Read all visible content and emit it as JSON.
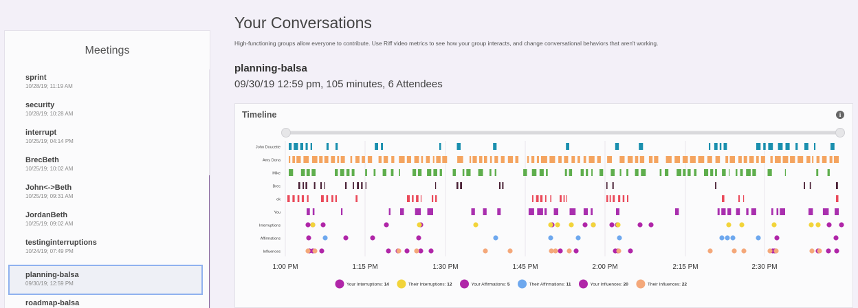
{
  "sidebar": {
    "title": "Meetings",
    "items": [
      {
        "name": "sprint",
        "date": "10/28/19; 11:19 AM"
      },
      {
        "name": "security",
        "date": "10/28/19; 10:28 AM"
      },
      {
        "name": "interrupt",
        "date": "10/25/19; 04:14 PM"
      },
      {
        "name": "BrecBeth",
        "date": "10/25/19; 10:02 AM"
      },
      {
        "name": "John<->Beth",
        "date": "10/25/19; 09:31 AM"
      },
      {
        "name": "JordanBeth",
        "date": "10/25/19; 09:02 AM"
      },
      {
        "name": "testinginterruptions",
        "date": "10/24/19; 07:49 PM"
      },
      {
        "name": "planning-balsa",
        "date": "09/30/19; 12:59 PM"
      },
      {
        "name": "roadmap-balsa",
        "date": ""
      }
    ],
    "selected_index": 7
  },
  "main": {
    "title": "Your Conversations",
    "intro": "High-functioning groups allow everyone to contribute. Use Riff video metrics to see how your group interacts, and change conversational behaviors that aren't working.",
    "meeting_title": "planning-balsa",
    "meeting_meta": "09/30/19 12:59 pm, 105 minutes, 6 Attendees"
  },
  "timeline": {
    "title": "Timeline",
    "info_icon": "info-icon",
    "rows": [
      "John Doucette",
      "Amy Dona",
      "Mike",
      "Brec",
      "ok",
      "You",
      "Interruptions",
      "Affirmations",
      "Influences"
    ],
    "time_ticks": [
      "1:00 PM",
      "1:15 PM",
      "1:30 PM",
      "1:45 PM",
      "2:00 PM",
      "2:15 PM",
      "2:30 PM"
    ],
    "colors": {
      "john": "#1a8fae",
      "amy": "#f4a460",
      "mike": "#5fae4d",
      "brec": "#4a2136",
      "ok": "#ea4a5a",
      "you": "#a92fae",
      "your_dot": "#b026a8",
      "their_interruption": "#f2d43a",
      "their_affirmation": "#6ea8ee",
      "their_influence": "#f4a87a"
    },
    "legend": [
      {
        "label": "Your Interruptions",
        "value": "14",
        "color": "#b026a8"
      },
      {
        "label": "Their Interruptions",
        "value": "12",
        "color": "#f2d43a"
      },
      {
        "label": "Your Affirmations",
        "value": "5",
        "color": "#b026a8"
      },
      {
        "label": "Their Affirmations",
        "value": "11",
        "color": "#6ea8ee"
      },
      {
        "label": "Your Influences",
        "value": "20",
        "color": "#b026a8"
      },
      {
        "label": "Their Influences",
        "value": "22",
        "color": "#f4a87a"
      }
    ]
  }
}
